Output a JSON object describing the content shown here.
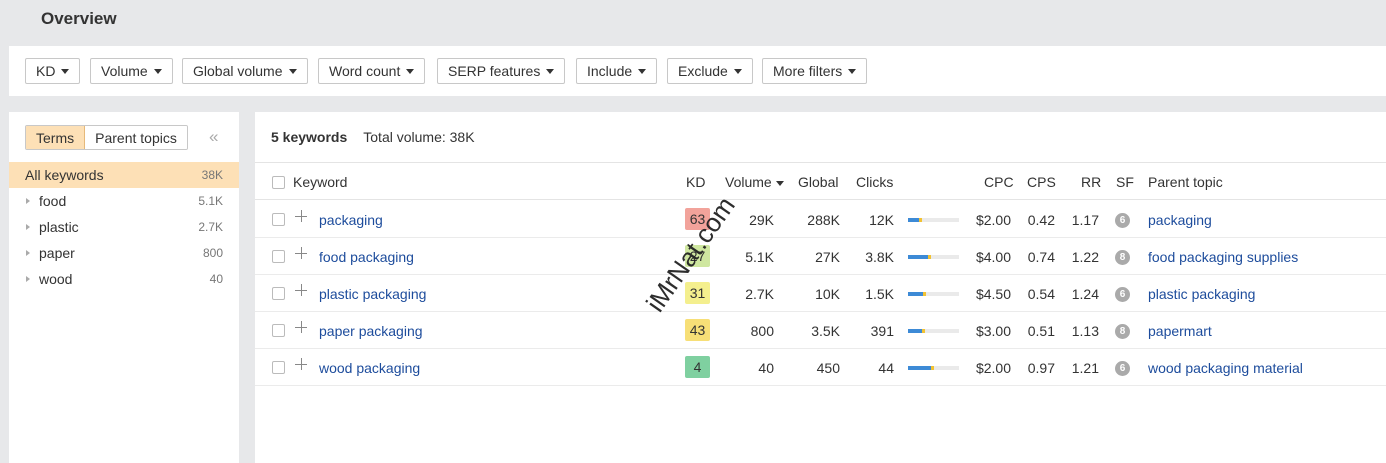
{
  "header": {
    "title": "Overview"
  },
  "filters": [
    "KD",
    "Volume",
    "Global volume",
    "Word count",
    "SERP features",
    "Include",
    "Exclude",
    "More filters"
  ],
  "side": {
    "tabs": [
      "Terms",
      "Parent topics"
    ],
    "collapse_glyph": "«",
    "items": [
      {
        "label": "All keywords",
        "count": "38K"
      },
      {
        "label": "food",
        "count": "5.1K"
      },
      {
        "label": "plastic",
        "count": "2.7K"
      },
      {
        "label": "paper",
        "count": "800"
      },
      {
        "label": "wood",
        "count": "40"
      }
    ]
  },
  "summary": {
    "count": "5 keywords",
    "volume": "Total volume: 38K"
  },
  "columns": [
    "Keyword",
    "KD",
    "Volume",
    "Global",
    "Clicks",
    "CPC",
    "CPS",
    "RR",
    "SF",
    "Parent topic"
  ],
  "rows": [
    {
      "keyword": "packaging",
      "kd": "63",
      "kd_color": "#f2a39b",
      "volume": "29K",
      "global": "288K",
      "clicks": "12K",
      "clicks_split": [
        0.22,
        0.06
      ],
      "cpc": "$2.00",
      "cps": "0.42",
      "rr": "1.17",
      "sf": "6",
      "parent": "packaging"
    },
    {
      "keyword": "food packaging",
      "kd": "27",
      "kd_color": "#cfe7a0",
      "volume": "5.1K",
      "global": "27K",
      "clicks": "3.8K",
      "clicks_split": [
        0.4,
        0.06
      ],
      "cpc": "$4.00",
      "cps": "0.74",
      "rr": "1.22",
      "sf": "8",
      "parent": "food packaging supplies"
    },
    {
      "keyword": "plastic packaging",
      "kd": "31",
      "kd_color": "#f4ef8e",
      "volume": "2.7K",
      "global": "10K",
      "clicks": "1.5K",
      "clicks_split": [
        0.3,
        0.06
      ],
      "cpc": "$4.50",
      "cps": "0.54",
      "rr": "1.24",
      "sf": "6",
      "parent": "plastic packaging"
    },
    {
      "keyword": "paper packaging",
      "kd": "43",
      "kd_color": "#f7df77",
      "volume": "800",
      "global": "3.5K",
      "clicks": "391",
      "clicks_split": [
        0.28,
        0.06
      ],
      "cpc": "$3.00",
      "cps": "0.51",
      "rr": "1.13",
      "sf": "8",
      "parent": "papermart"
    },
    {
      "keyword": "wood packaging",
      "kd": "4",
      "kd_color": "#7fd0a0",
      "volume": "40",
      "global": "450",
      "clicks": "44",
      "clicks_split": [
        0.46,
        0.06
      ],
      "cpc": "$2.00",
      "cps": "0.97",
      "rr": "1.21",
      "sf": "6",
      "parent": "wood packaging material"
    }
  ],
  "colors": {
    "link": "#1d4c9c",
    "active": "#fde0b6",
    "bar_blue": "#3d8ad6",
    "bar_yellow": "#f2c232"
  },
  "watermark": "iMrNat.com"
}
